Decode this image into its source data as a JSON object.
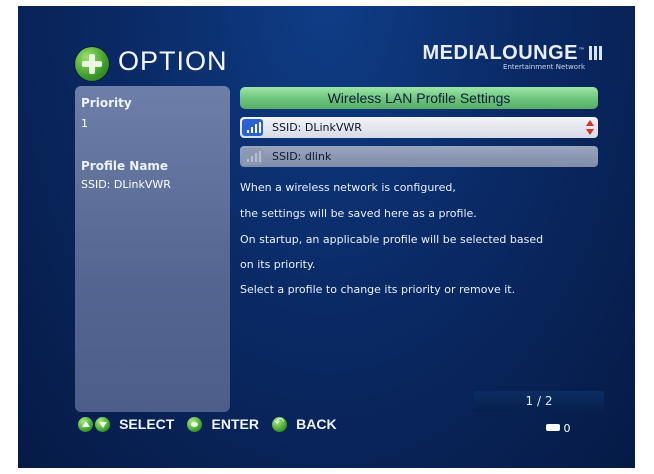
{
  "header": {
    "title": "OPTION",
    "brand": "MEDIALOUNGE",
    "brand_tm": "™",
    "brand_sub": "Entertainment Network"
  },
  "left_panel": {
    "priority_label": "Priority",
    "priority_value": "1",
    "profile_name_label": "Profile Name",
    "profile_name_value": "SSID: DLinkVWR"
  },
  "main": {
    "title": "Wireless LAN Profile Settings",
    "profiles": [
      {
        "label": "SSID: DLinkVWR",
        "selected": true
      },
      {
        "label": "SSID: dlink",
        "selected": false
      }
    ],
    "description": [
      "When a wireless network is configured,",
      "the settings will be saved here as a profile.",
      "On startup, an applicable profile will be selected based",
      "on its priority.",
      "Select a profile to change its priority or remove it."
    ],
    "page_indicator": "1 / 2"
  },
  "footer": {
    "select_label": "SELECT",
    "enter_label": "ENTER",
    "back_label": "BACK",
    "network_count": "0"
  },
  "colors": {
    "accent_green": "#6cc47b",
    "selected_icon": "#2a62d6",
    "updown_arrows": "#d9322a"
  }
}
